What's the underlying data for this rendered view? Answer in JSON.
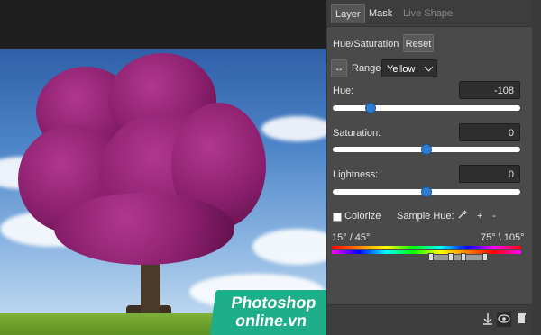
{
  "tabs": [
    {
      "label": "Layer"
    },
    {
      "label": "Mask"
    },
    {
      "label": "Live Shape"
    }
  ],
  "adjustment": {
    "title": "Hue/Saturation",
    "reset_label": "Reset",
    "range_label": "Range:",
    "range_value": "Yellow",
    "hue_label": "Hue:",
    "hue_value": "-108",
    "hue_level": 0.2,
    "saturation_label": "Saturation:",
    "saturation_value": "0",
    "saturation_level": 0.5,
    "lightness_label": "Lightness:",
    "lightness_value": "0",
    "lightness_level": 0.5,
    "colorize_label": "Colorize",
    "sample_hue_label": "Sample Hue:",
    "plus_label": "+",
    "minus_label": "-",
    "range_left_text": "15° / 45°",
    "range_right_text": "75° \\ 105°"
  },
  "watermark": {
    "line1": "Photoshop",
    "line2": "online.vn"
  },
  "icons": {
    "swap": "arrows-swap-icon",
    "eyedropper": "eyedropper-icon",
    "clip": "clip-to-layer-icon",
    "visibility": "eye-icon",
    "delete": "trash-icon"
  },
  "colors": {
    "panel_bg": "#4a4a4a",
    "accent": "#2d7dd2",
    "watermark": "#1fae8a"
  }
}
